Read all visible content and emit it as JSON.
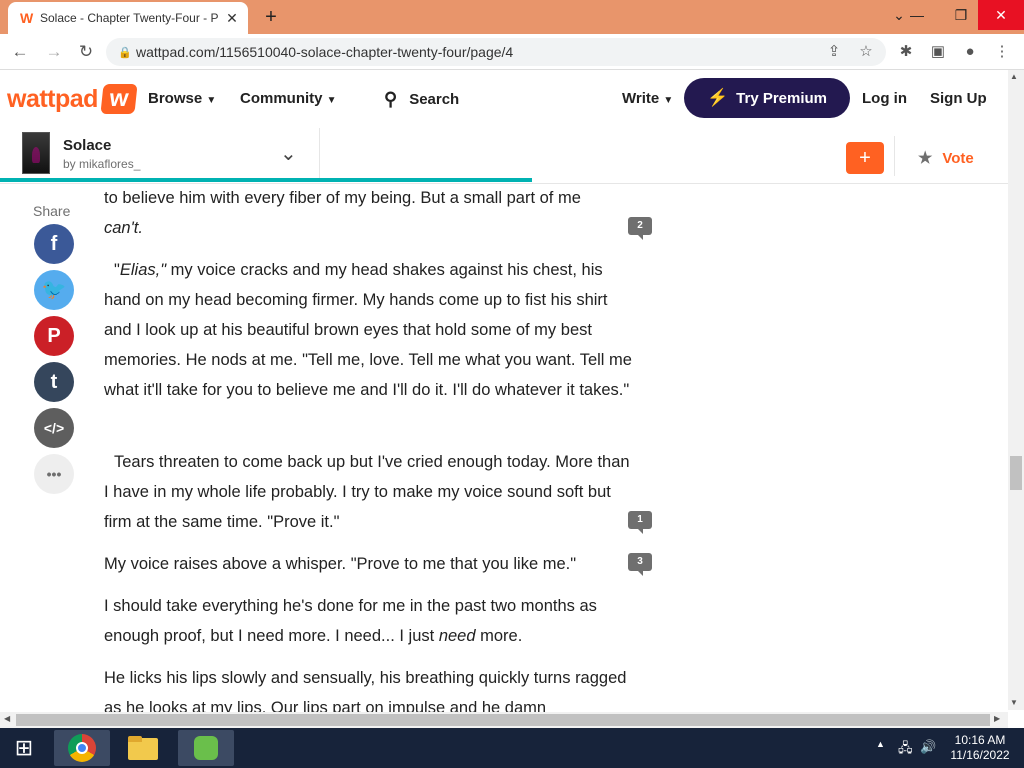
{
  "browser": {
    "tab_title": "Solace - Chapter Twenty-Four - P",
    "tab_favicon": "W",
    "new_tab": "+",
    "url": "wattpad.com/1156510040-solace-chapter-twenty-four/page/4"
  },
  "site": {
    "logo_text": "wattpad",
    "logo_mark": "w",
    "nav": {
      "browse": "Browse",
      "community": "Community",
      "search": "Search",
      "write": "Write"
    },
    "premium": "Try Premium",
    "login": "Log in",
    "signup": "Sign Up"
  },
  "story": {
    "title": "Solace",
    "author": "by mikaflores_",
    "add": "+",
    "vote": "Vote",
    "progress": 0.52
  },
  "share": {
    "label": "Share",
    "buttons": [
      {
        "name": "facebook",
        "glyph": "f",
        "color": "#3b5998"
      },
      {
        "name": "twitter",
        "glyph": "🐦",
        "color": "#55acee"
      },
      {
        "name": "pinterest",
        "glyph": "P",
        "color": "#cb2027"
      },
      {
        "name": "tumblr",
        "glyph": "t",
        "color": "#35465c"
      },
      {
        "name": "embed",
        "glyph": "</>",
        "color": "#5e5e5e"
      },
      {
        "name": "more",
        "glyph": "•••",
        "color": "#eeeeee"
      }
    ]
  },
  "chapter": {
    "p1a": "to believe him with every fiber of my being. But a small part of me",
    "p1b": "can't.",
    "p2_open": "\"",
    "p2_name": "Elias,\"",
    "p2_rest": " my voice cracks and my head shakes against his chest, his hand on my head becoming firmer. My hands come up to fist his shirt and I look up at his beautiful brown eyes that hold some of my best memories. He nods at me. \"Tell me, love. Tell me what you want. Tell me what it'll take for you to believe me and I'll do it. I'll do whatever it takes.\"",
    "p3": "Tears threaten to come back up but I've cried enough today. More than I have in my whole life probably. I try to make my voice sound soft but firm at the same time. \"Prove it.\"",
    "p4": "My voice raises above a whisper. \"Prove to me that you like me.\"",
    "p5a": "I should take everything he's done for me in the past two months as enough proof, but I need more. I need... I just ",
    "p5b": "need",
    "p5c": " more.",
    "p6": "He licks his lips slowly and sensually, his breathing quickly turns ragged as he looks at my lips. Our lips part on impulse and he damn",
    "comments": [
      "2",
      "1",
      "3"
    ]
  },
  "taskbar": {
    "time": "10:16 AM",
    "date": "11/16/2022"
  }
}
